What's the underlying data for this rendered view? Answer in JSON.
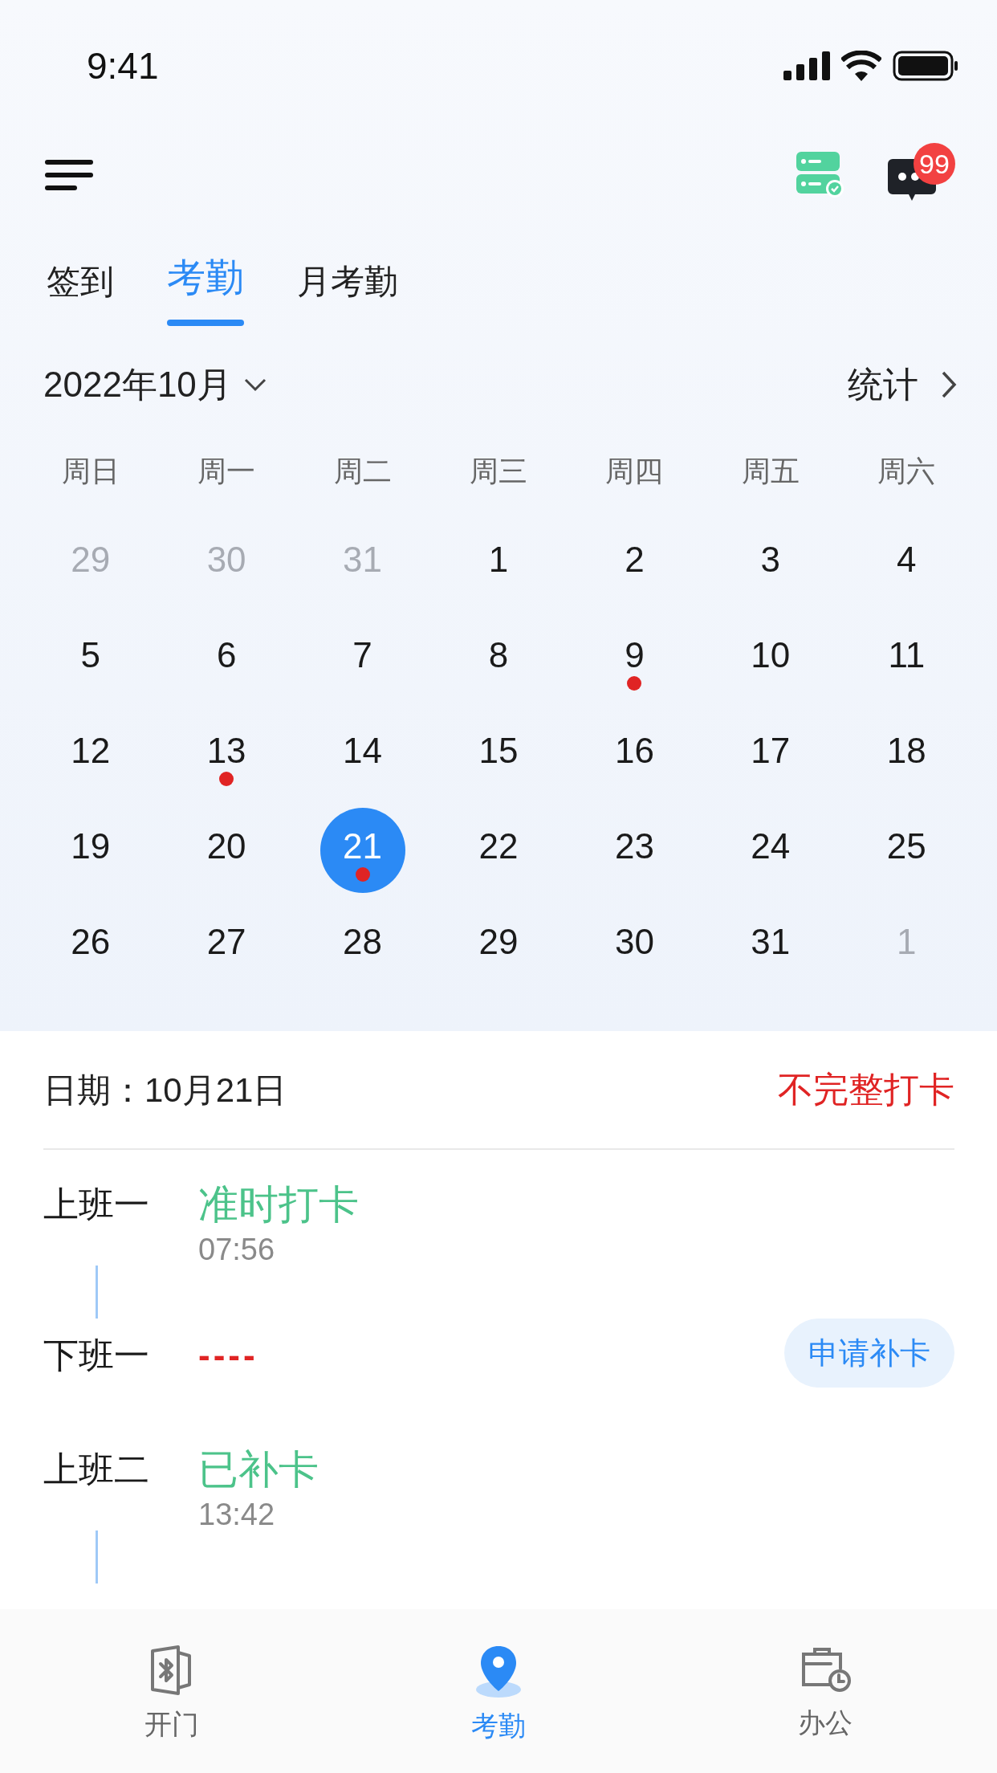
{
  "status_bar": {
    "time": "9:41"
  },
  "header": {
    "message_badge": "99"
  },
  "tabs": [
    {
      "label": "签到",
      "selected": false
    },
    {
      "label": "考勤",
      "selected": true
    },
    {
      "label": "月考勤",
      "selected": false
    }
  ],
  "month": {
    "label": "2022年10月",
    "stats": "统计"
  },
  "weekdays": [
    "周日",
    "周一",
    "周二",
    "周三",
    "周四",
    "周五",
    "周六"
  ],
  "weeks": [
    [
      {
        "day": "29",
        "outside": true,
        "dot": false,
        "selected": false
      },
      {
        "day": "30",
        "outside": true,
        "dot": false,
        "selected": false
      },
      {
        "day": "31",
        "outside": true,
        "dot": false,
        "selected": false
      },
      {
        "day": "1",
        "outside": false,
        "dot": false,
        "selected": false
      },
      {
        "day": "2",
        "outside": false,
        "dot": false,
        "selected": false
      },
      {
        "day": "3",
        "outside": false,
        "dot": false,
        "selected": false
      },
      {
        "day": "4",
        "outside": false,
        "dot": false,
        "selected": false
      }
    ],
    [
      {
        "day": "5",
        "outside": false,
        "dot": false,
        "selected": false
      },
      {
        "day": "6",
        "outside": false,
        "dot": false,
        "selected": false
      },
      {
        "day": "7",
        "outside": false,
        "dot": false,
        "selected": false
      },
      {
        "day": "8",
        "outside": false,
        "dot": false,
        "selected": false
      },
      {
        "day": "9",
        "outside": false,
        "dot": true,
        "selected": false
      },
      {
        "day": "10",
        "outside": false,
        "dot": false,
        "selected": false
      },
      {
        "day": "11",
        "outside": false,
        "dot": false,
        "selected": false
      }
    ],
    [
      {
        "day": "12",
        "outside": false,
        "dot": false,
        "selected": false
      },
      {
        "day": "13",
        "outside": false,
        "dot": true,
        "selected": false
      },
      {
        "day": "14",
        "outside": false,
        "dot": false,
        "selected": false
      },
      {
        "day": "15",
        "outside": false,
        "dot": false,
        "selected": false
      },
      {
        "day": "16",
        "outside": false,
        "dot": false,
        "selected": false
      },
      {
        "day": "17",
        "outside": false,
        "dot": false,
        "selected": false
      },
      {
        "day": "18",
        "outside": false,
        "dot": false,
        "selected": false
      }
    ],
    [
      {
        "day": "19",
        "outside": false,
        "dot": false,
        "selected": false
      },
      {
        "day": "20",
        "outside": false,
        "dot": false,
        "selected": false
      },
      {
        "day": "21",
        "outside": false,
        "dot": true,
        "selected": true
      },
      {
        "day": "22",
        "outside": false,
        "dot": false,
        "selected": false
      },
      {
        "day": "23",
        "outside": false,
        "dot": false,
        "selected": false
      },
      {
        "day": "24",
        "outside": false,
        "dot": false,
        "selected": false
      },
      {
        "day": "25",
        "outside": false,
        "dot": false,
        "selected": false
      }
    ],
    [
      {
        "day": "26",
        "outside": false,
        "dot": false,
        "selected": false
      },
      {
        "day": "27",
        "outside": false,
        "dot": false,
        "selected": false
      },
      {
        "day": "28",
        "outside": false,
        "dot": false,
        "selected": false
      },
      {
        "day": "29",
        "outside": false,
        "dot": false,
        "selected": false
      },
      {
        "day": "30",
        "outside": false,
        "dot": false,
        "selected": false
      },
      {
        "day": "31",
        "outside": false,
        "dot": false,
        "selected": false
      },
      {
        "day": "1",
        "outside": true,
        "dot": false,
        "selected": false
      }
    ]
  ],
  "detail": {
    "date": "日期：10月21日",
    "status": "不完整打卡"
  },
  "shifts": [
    {
      "records": [
        {
          "label": "上班一",
          "kind": "ok",
          "status": "准时打卡",
          "time": "07:56"
        },
        {
          "label": "下班一",
          "kind": "missing",
          "status": "----",
          "action": "申请补卡"
        }
      ]
    },
    {
      "records": [
        {
          "label": "上班二",
          "kind": "ok",
          "status": "已补卡",
          "time": "13:42"
        }
      ]
    }
  ],
  "bottom_nav": [
    {
      "label": "开门",
      "selected": false
    },
    {
      "label": "考勤",
      "selected": true
    },
    {
      "label": "办公",
      "selected": false
    }
  ]
}
